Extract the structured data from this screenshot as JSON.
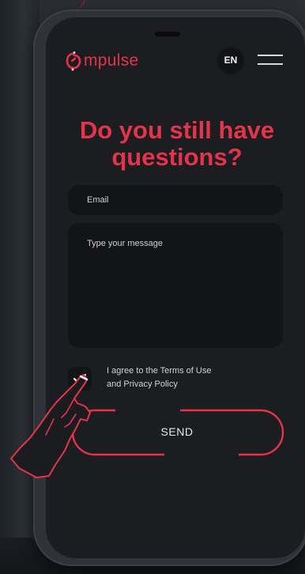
{
  "brand": {
    "name": "mpulse",
    "accent": "#e5344a"
  },
  "header": {
    "language": "EN",
    "menu_icon": "hamburger-icon"
  },
  "title": {
    "line1": "Do you still have",
    "line2": "questions?"
  },
  "form": {
    "email_placeholder": "Email",
    "message_placeholder": "Type your message",
    "agree_line1": "I agree to the Terms of Use",
    "agree_line2": "and Privacy Policy",
    "agree_checked": true,
    "send_label": "SEND"
  },
  "colors": {
    "background": "#2a2d33",
    "screen": "#1c1d21",
    "field": "#131417",
    "accent": "#e5344a"
  }
}
